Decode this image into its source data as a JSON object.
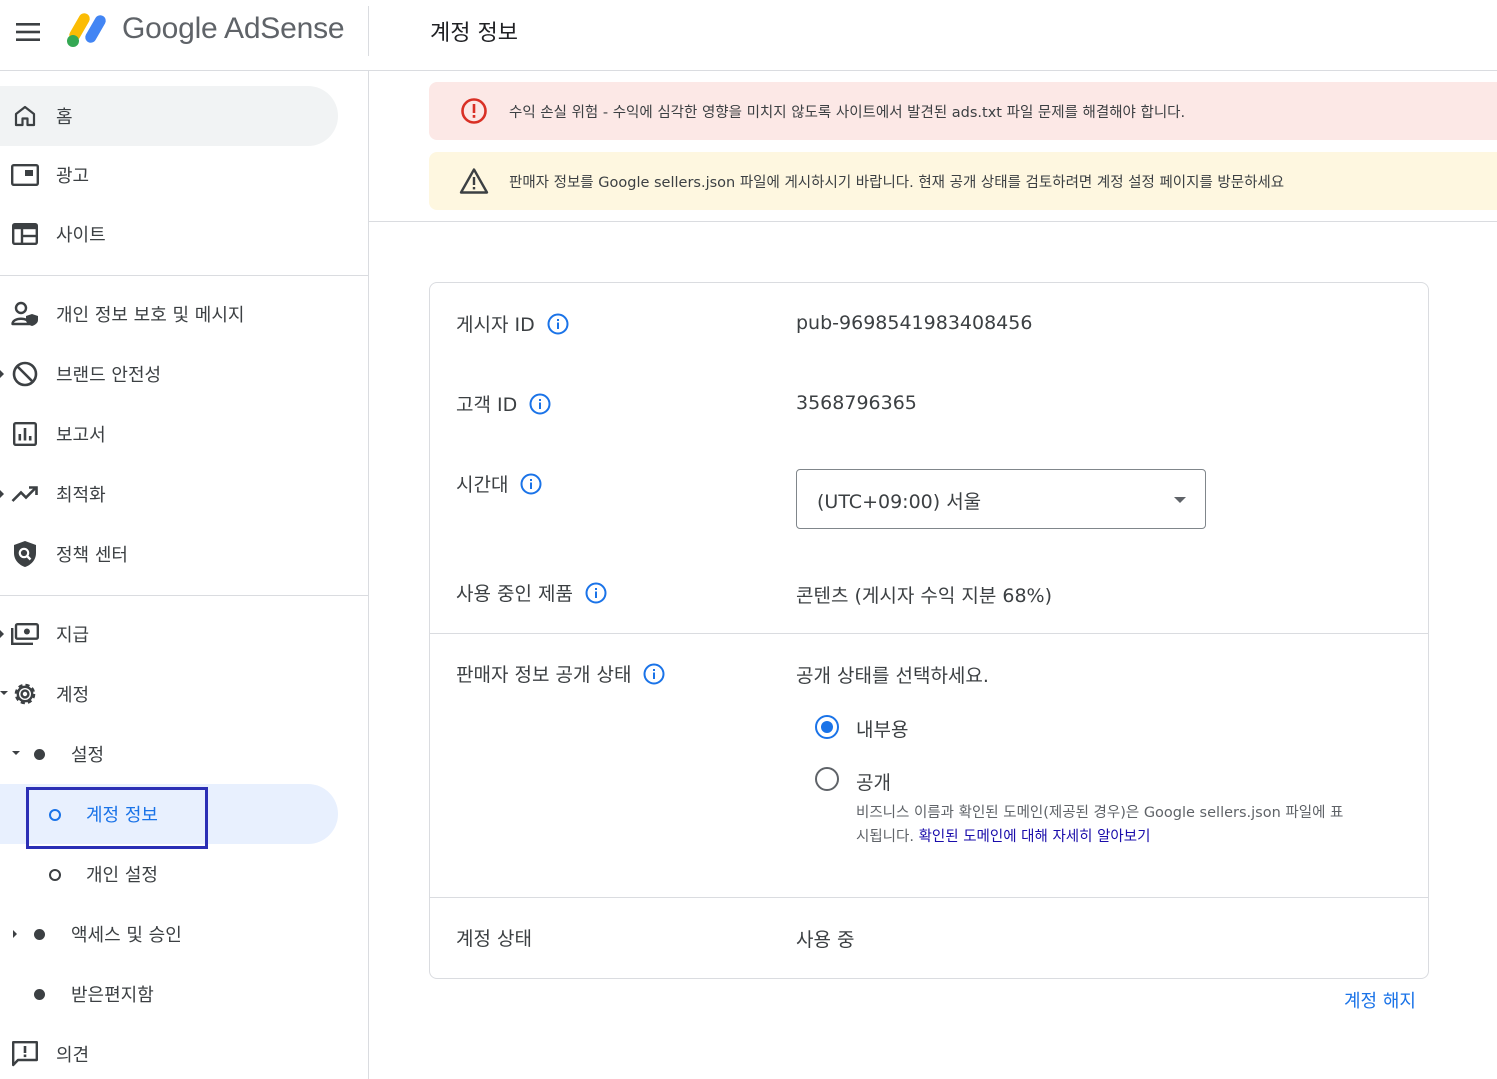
{
  "header": {
    "brand": "Google AdSense",
    "page_title": "계정 정보"
  },
  "sidebar": {
    "items": [
      {
        "label": "홈",
        "icon": "home-icon"
      },
      {
        "label": "광고",
        "icon": "ads-icon"
      },
      {
        "label": "사이트",
        "icon": "sites-icon"
      },
      {
        "label": "개인 정보 보호 및 메시지",
        "icon": "privacy-messaging-icon"
      },
      {
        "label": "브랜드 안전성",
        "icon": "block-icon"
      },
      {
        "label": "보고서",
        "icon": "reports-icon"
      },
      {
        "label": "최적화",
        "icon": "trending-up-icon"
      },
      {
        "label": "정책 센터",
        "icon": "policy-shield-icon"
      },
      {
        "label": "지급",
        "icon": "payments-icon"
      },
      {
        "label": "계정",
        "icon": "gear-icon"
      },
      {
        "label": "설정"
      },
      {
        "label": "계정 정보"
      },
      {
        "label": "개인 설정"
      },
      {
        "label": "액세스 및 승인"
      },
      {
        "label": "받은편지함"
      },
      {
        "label": "의견",
        "icon": "feedback-icon"
      }
    ]
  },
  "banners": {
    "error": "수익 손실 위험 - 수익에 심각한 영향을 미치지 않도록 사이트에서 발견된 ads.txt 파일 문제를 해결해야 합니다.",
    "warning": "판매자 정보를 Google sellers.json 파일에 게시하시기 바랍니다. 현재 공개 상태를 검토하려면 계정 설정 페이지를 방문하세요"
  },
  "account": {
    "publisher_id_label": "게시자 ID",
    "publisher_id": "pub-9698541983408456",
    "customer_id_label": "고객 ID",
    "customer_id": "3568796365",
    "timezone_label": "시간대",
    "timezone": "(UTC+09:00) 서울",
    "products_label": "사용 중인 제품",
    "products": "콘텐츠 (게시자 수익 지분 68%)",
    "seller_visibility_label": "판매자 정보 공개 상태",
    "seller_visibility_prompt": "공개 상태를 선택하세요.",
    "visibility_options": [
      {
        "label": "내부용",
        "checked": true
      },
      {
        "label": "공개",
        "checked": false
      }
    ],
    "public_description": "비즈니스 이름과 확인된 도메인(제공된 경우)은 Google sellers.json 파일에 표시됩니다. ",
    "public_link": "확인된 도메인에 대해 자세히 알아보기",
    "status_label": "계정 상태",
    "status": "사용 중",
    "close_account": "계정 해지"
  },
  "colors": {
    "accent": "#1a73e8",
    "error_bg": "#fce8e6",
    "error_icon": "#d93025",
    "warning_bg": "#fef7e0",
    "highlight_box": "#2b2fb5"
  }
}
